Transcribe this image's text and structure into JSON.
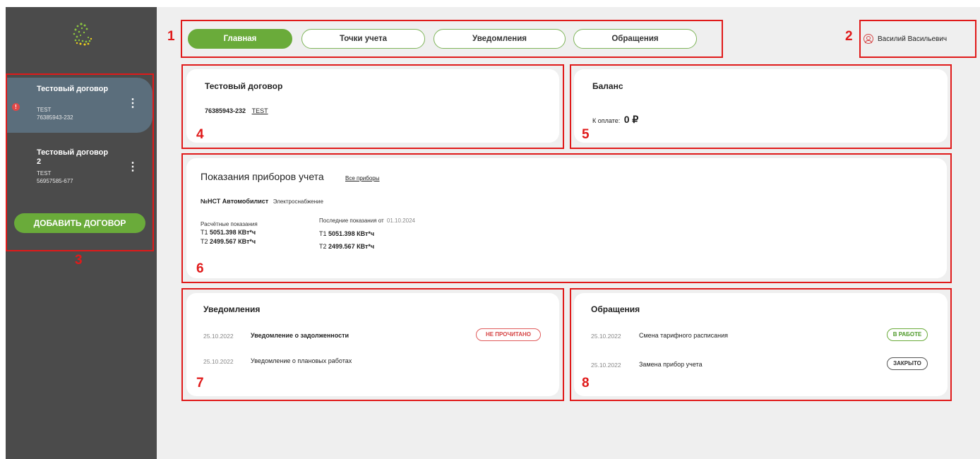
{
  "sidebar": {
    "contracts": [
      {
        "name": "Тестовый договор",
        "code": "TEST",
        "number": "76385943-232",
        "alert": "!"
      },
      {
        "name": "Тестовый договор 2",
        "code": "TEST",
        "number": "56957585-677"
      }
    ],
    "kebab": "⋮",
    "add_button": "ДОБАВИТЬ ДОГОВОР"
  },
  "tabs": [
    "Главная",
    "Точки учета",
    "Уведомления",
    "Обращения"
  ],
  "user": {
    "name": "Василий Васильевич"
  },
  "contract_card": {
    "title": "Тестовый договор",
    "number": "76385943-232",
    "code": "TEST"
  },
  "balance_card": {
    "title": "Баланс",
    "label": "К оплате:",
    "amount": "0 ₽"
  },
  "meters_card": {
    "title": "Показания приборов учета",
    "all_link": "Все приборы",
    "point_name": "№НСТ Автомобилист",
    "service": "Электроснабжение",
    "calc_label": "Расчётные показания",
    "last_label": "Последние показания от",
    "last_date": "01.10.2024",
    "calc": [
      {
        "tariff": "Т1",
        "value": "5051.398 КВт*ч"
      },
      {
        "tariff": "Т2",
        "value": "2499.567 КВт*ч"
      }
    ],
    "last": [
      {
        "tariff": "Т1",
        "value": "5051.398 КВт*ч"
      },
      {
        "tariff": "Т2",
        "value": "2499.567 КВт*ч"
      }
    ]
  },
  "notifications_card": {
    "title": "Уведомления",
    "items": [
      {
        "date": "25.10.2022",
        "text": "Уведомление о задолженности",
        "badge": "НЕ ПРОЧИТАНО"
      },
      {
        "date": "25.10.2022",
        "text": "Уведомление о плановых работах"
      }
    ]
  },
  "requests_card": {
    "title": "Обращения",
    "items": [
      {
        "date": "25.10.2022",
        "text": "Смена тарифного расписания",
        "badge": "В РАБОТЕ"
      },
      {
        "date": "25.10.2022",
        "text": "Замена прибор учета",
        "badge": "ЗАКРЫТО"
      }
    ]
  },
  "annotations": [
    "1",
    "2",
    "3",
    "4",
    "5",
    "6",
    "7",
    "8"
  ],
  "colors": {
    "accent_green": "#6aab3a",
    "sidebar_bg": "#4b4b4b",
    "active_contract_bg": "#5b6e7c",
    "annotation_red": "#e01a1a"
  }
}
